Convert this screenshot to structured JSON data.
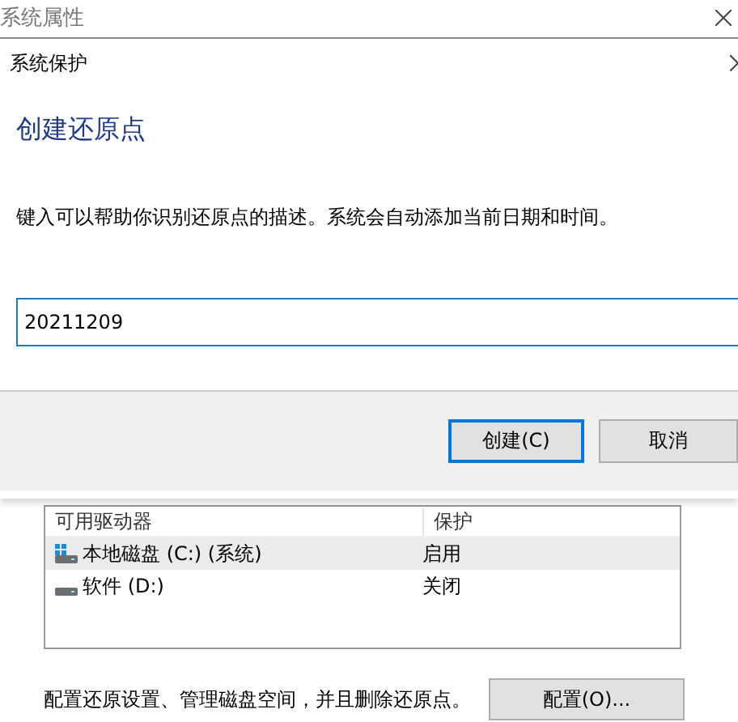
{
  "background_window": {
    "title": "系统属性",
    "drives_list": {
      "columns": [
        "可用驱动器",
        "保护"
      ],
      "rows": [
        {
          "drive": "本地磁盘 (C:) (系统)",
          "protection": "启用",
          "kind": "system",
          "selected": true
        },
        {
          "drive": "软件 (D:)",
          "protection": "关闭",
          "kind": "disk",
          "selected": false
        }
      ]
    },
    "configure_text": "配置还原设置、管理磁盘空间，并且删除还原点。",
    "configure_button": "配置(O)..."
  },
  "dialog": {
    "title": "系统保护",
    "heading": "创建还原点",
    "description": "键入可以帮助你识别还原点的描述。系统会自动添加当前日期和时间。",
    "input": {
      "value": "20211209"
    },
    "buttons": [
      {
        "label": "创建(C)",
        "default": true
      },
      {
        "label": "取消",
        "default": false
      }
    ]
  }
}
